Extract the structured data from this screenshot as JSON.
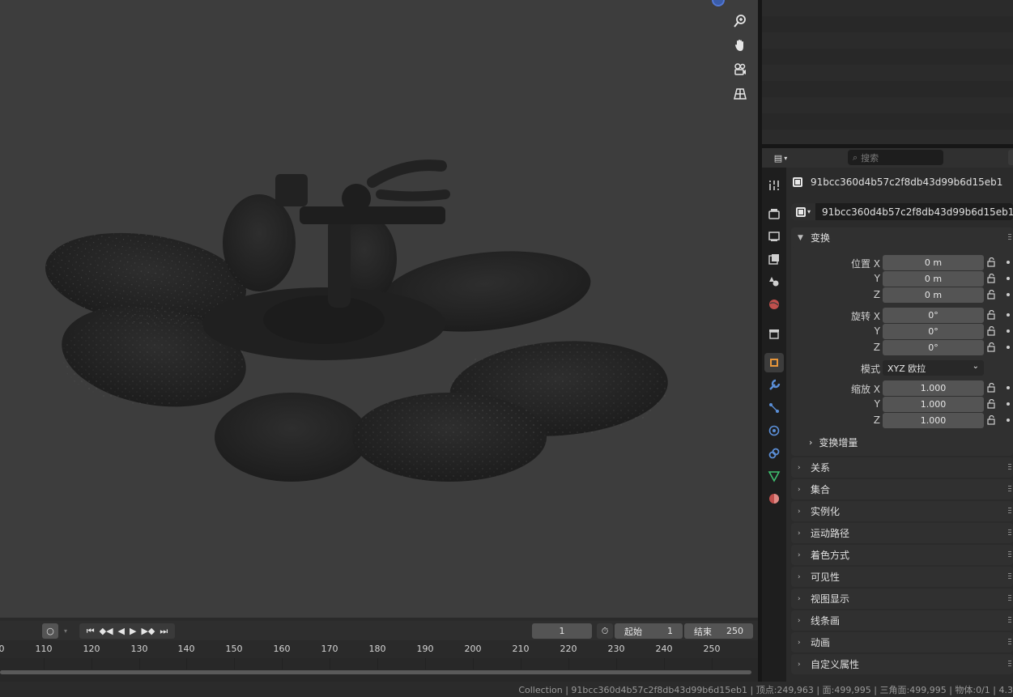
{
  "viewport": {
    "nav_icons": [
      "zoom-icon",
      "hand-pan-icon",
      "camera-icon",
      "grid-icon"
    ]
  },
  "properties": {
    "search_placeholder": "搜索",
    "object_name": "91bcc360d4b57c2f8db43d99b6d15eb1",
    "object_data_name": "91bcc360d4b57c2f8db43d99b6d15eb1",
    "tabs": [
      "tool-icon",
      "render-icon",
      "output-icon",
      "view-layer-icon",
      "scene-icon",
      "world-icon",
      "collection-icon",
      "object-icon",
      "modifier-icon",
      "particles-icon",
      "physics-icon",
      "constraints-icon",
      "data-icon",
      "material-icon"
    ],
    "transform": {
      "header": "变换",
      "location_label": "位置 X",
      "y_label": "Y",
      "z_label": "Z",
      "location": [
        "0 m",
        "0 m",
        "0 m"
      ],
      "rotation_label": "旋转 X",
      "rotation": [
        "0°",
        "0°",
        "0°"
      ],
      "mode_label": "模式",
      "mode_value": "XYZ 欧拉",
      "scale_label": "缩放 X",
      "scale": [
        "1.000",
        "1.000",
        "1.000"
      ],
      "delta_header": "变换增量"
    },
    "panels": [
      "关系",
      "集合",
      "实例化",
      "运动路径",
      "着色方式",
      "可见性",
      "视图显示",
      "线条画",
      "动画",
      "自定义属性"
    ]
  },
  "timeline": {
    "current_frame": "1",
    "start_label": "起始",
    "start_value": "1",
    "end_label": "结束",
    "end_value": "250",
    "ruler": [
      "0",
      "110",
      "120",
      "130",
      "140",
      "150",
      "160",
      "170",
      "180",
      "190",
      "200",
      "210",
      "220",
      "230",
      "240",
      "250"
    ]
  },
  "status_bar": "Collection | 91bcc360d4b57c2f8db43d99b6d15eb1 | 顶点:249,963 | 面:499,995 | 三角面:499,995 | 物体:0/1 | 4.3"
}
